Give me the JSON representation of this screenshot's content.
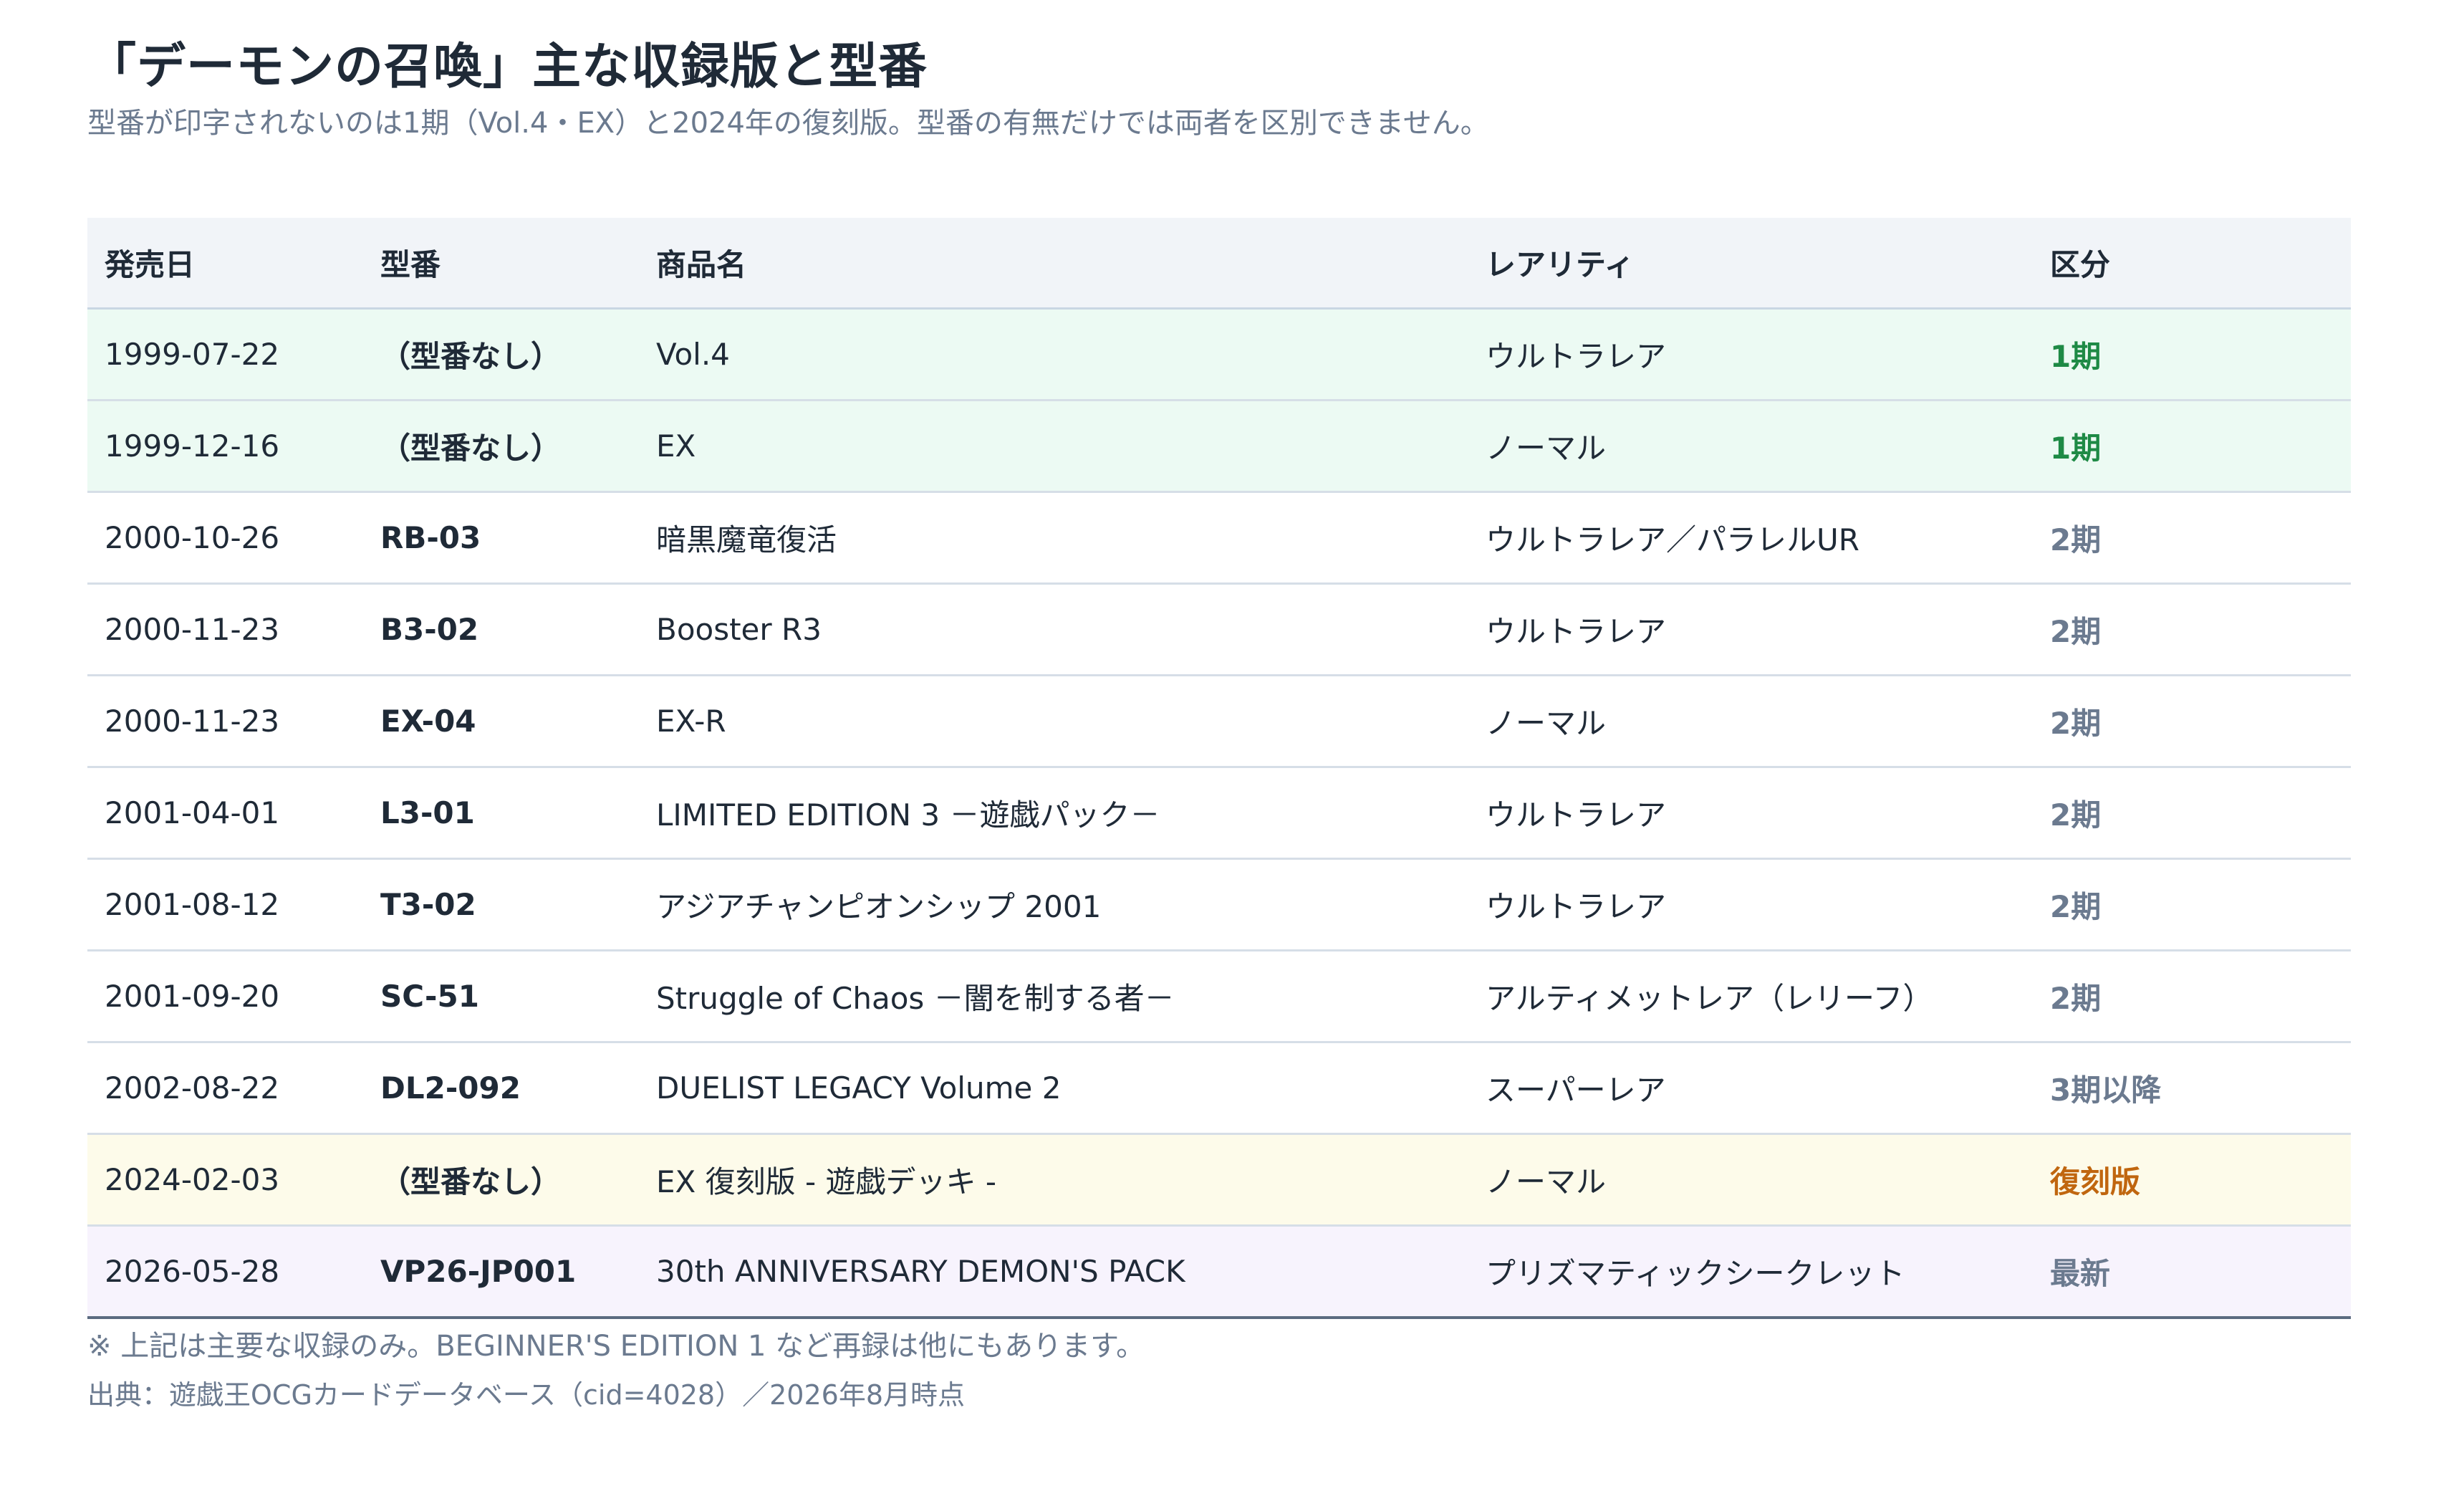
{
  "title": "「デーモンの召喚」主な収録版と型番",
  "subtitle": "型番が印字されないのは1期（Vol.4・EX）と2024年の復刻版。型番の有無だけでは両者を区別できません。",
  "table": {
    "headers": [
      "発売日",
      "型番",
      "商品名",
      "レアリティ",
      "区分"
    ],
    "rows": [
      {
        "date": "1999-07-22",
        "code": "（型番なし）",
        "product": "Vol.4",
        "rarity": "ウルトラレア",
        "category": "1期",
        "kind": "gen1"
      },
      {
        "date": "1999-12-16",
        "code": "（型番なし）",
        "product": "EX",
        "rarity": "ノーマル",
        "category": "1期",
        "kind": "gen1"
      },
      {
        "date": "2000-10-26",
        "code": "RB-03",
        "product": "暗黒魔竜復活",
        "rarity": "ウルトラレア／パラレルUR",
        "category": "2期",
        "kind": "normal"
      },
      {
        "date": "2000-11-23",
        "code": "B3-02",
        "product": "Booster R3",
        "rarity": "ウルトラレア",
        "category": "2期",
        "kind": "normal"
      },
      {
        "date": "2000-11-23",
        "code": "EX-04",
        "product": "EX-R",
        "rarity": "ノーマル",
        "category": "2期",
        "kind": "normal"
      },
      {
        "date": "2001-04-01",
        "code": "L3-01",
        "product": "LIMITED EDITION 3 －遊戯パック－",
        "rarity": "ウルトラレア",
        "category": "2期",
        "kind": "normal"
      },
      {
        "date": "2001-08-12",
        "code": "T3-02",
        "product": "アジアチャンピオンシップ 2001",
        "rarity": "ウルトラレア",
        "category": "2期",
        "kind": "normal"
      },
      {
        "date": "2001-09-20",
        "code": "SC-51",
        "product": "Struggle of Chaos －闇を制する者－",
        "rarity": "アルティメットレア（レリーフ）",
        "category": "2期",
        "kind": "normal"
      },
      {
        "date": "2002-08-22",
        "code": "DL2-092",
        "product": "DUELIST LEGACY Volume 2",
        "rarity": "スーパーレア",
        "category": "3期以降",
        "kind": "normal"
      },
      {
        "date": "2024-02-03",
        "code": "（型番なし）",
        "product": "EX 復刻版 - 遊戯デッキ -",
        "rarity": "ノーマル",
        "category": "復刻版",
        "kind": "revival"
      },
      {
        "date": "2026-05-28",
        "code": "VP26-JP001",
        "product": "30th ANNIVERSARY DEMON'S PACK",
        "rarity": "プリズマティックシークレット",
        "category": "最新",
        "kind": "latest"
      }
    ]
  },
  "colors": {
    "gen1_row_bg": "#ecfaf3",
    "gen1_text": "#1e8a45",
    "revival_row_bg": "#fdfbea",
    "revival_text": "#c0660f",
    "latest_row_bg": "#f7f3fd",
    "muted_text": "#6b7a8f"
  },
  "footer": {
    "note": "※ 上記は主要な収録のみ。BEGINNER'S EDITION 1 など再録は他にもあります。",
    "source": "出典：遊戯王OCGカードデータベース（cid=4028）／2026年8月時点"
  }
}
